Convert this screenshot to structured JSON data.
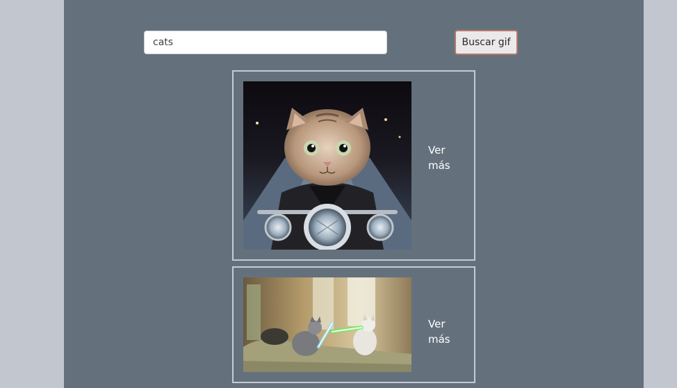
{
  "search": {
    "value": "cats",
    "button_label": "Buscar gif"
  },
  "results": [
    {
      "image": "cat-on-motorcycle-gif",
      "link_label_line1": "Ver",
      "link_label_line2": "más"
    },
    {
      "image": "cats-lightsaber-fight-gif",
      "link_label_line1": "Ver",
      "link_label_line2": "más"
    }
  ],
  "colors": {
    "page_background": "#c2c6cf",
    "panel_background": "#64717d",
    "card_border": "#c4ccd6",
    "button_border": "#b8786a",
    "button_background": "#ebe9e9"
  }
}
